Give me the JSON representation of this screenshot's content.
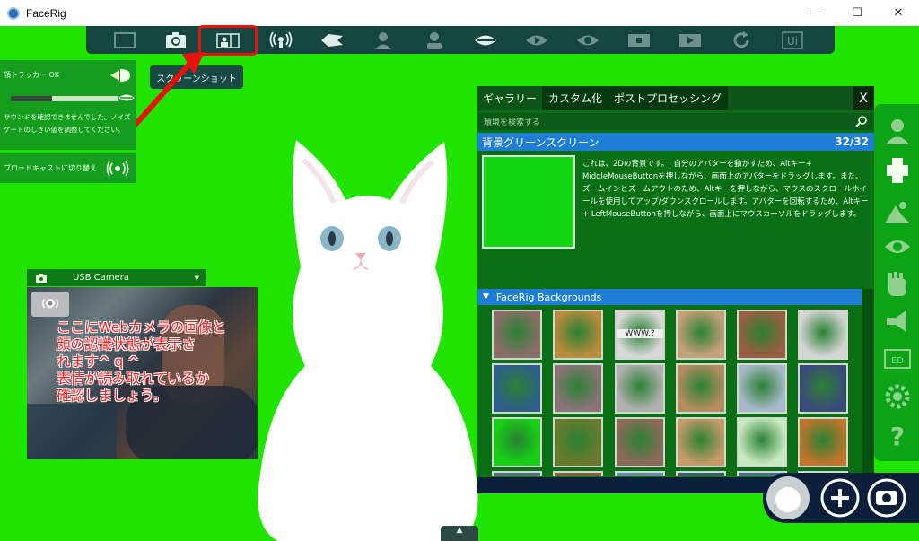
{
  "window": {
    "title": "FaceRig",
    "minimize": "—",
    "maximize": "☐",
    "close": "✕"
  },
  "toolbar": {
    "items": [
      {
        "name": "fullscreen-icon",
        "state": "dim"
      },
      {
        "name": "camera-icon",
        "state": "normal"
      },
      {
        "name": "screenshot-icon",
        "state": "active"
      },
      {
        "name": "broadcast-icon",
        "state": "normal"
      },
      {
        "name": "eye-mask-icon",
        "state": "normal"
      },
      {
        "name": "avatar-icon",
        "state": "dim"
      },
      {
        "name": "avatar-alt-icon",
        "state": "dim"
      },
      {
        "name": "lips-icon",
        "state": "normal"
      },
      {
        "name": "play-eye-icon",
        "state": "dim"
      },
      {
        "name": "record-eye-icon",
        "state": "dim"
      },
      {
        "name": "film-icon",
        "state": "dim"
      },
      {
        "name": "film-play-icon",
        "state": "dim"
      },
      {
        "name": "refresh-icon",
        "state": "dim"
      },
      {
        "name": "ui-toggle-icon",
        "state": "dim"
      }
    ],
    "ui_label": "Ui"
  },
  "tooltip": {
    "text": "スクリーンショット"
  },
  "tracker": {
    "status": "顔トラッカー OK",
    "message": "サウンドを確認できませんでした。ノイズゲートのしきい値を調整してください。",
    "slider_level": 0.38,
    "broadcast_label": "ブロードキャストに切り替え"
  },
  "camera": {
    "label": "USB Camera",
    "dropdown": "▼",
    "note": "ここにWebカメラの画像と\n顔の認識状態が表示さ\nれます^ q ^\n表情が読み取れているか\n確認しましょう。"
  },
  "gallery": {
    "tabs": [
      "ギャラリー",
      "カスタム化",
      "ポストプロセッシング"
    ],
    "close": "X",
    "search_placeholder": "環境を検索する",
    "selected_name": "背景グリーンスクリーン",
    "selected_count": "32/32",
    "description": "これは、2Dの背景です。. 自分のアバターを動かすため、Altキー+ MiddleMouseButtonを押しながら、画面上のアバターをドラッグします。また、ズームインとズームアウトのため、Altキーを押しながら、マウスのスクロールホイールを使用してアップ/ダウンスクロールします。アバターを回転するため、Altキー+ LeftMouseButtonを押しながら、画面上にマウスカーソルをドラッグします。",
    "category": "FaceRig Backgrounds",
    "category_toggle": "▼",
    "thumbnails": [
      {
        "color": "#8a6e68",
        "label": ""
      },
      {
        "color": "#b98a3c",
        "label": ""
      },
      {
        "color": "#d8d8d8",
        "label": "WWW.?"
      },
      {
        "color": "#c4a078",
        "label": ""
      },
      {
        "color": "#9a5e42",
        "label": ""
      },
      {
        "color": "#d4d4d4",
        "label": ""
      },
      {
        "color": "#2e5e8c",
        "label": ""
      },
      {
        "color": "#8a7478",
        "label": ""
      },
      {
        "color": "#b0b0b0",
        "label": ""
      },
      {
        "color": "#b48c60",
        "label": ""
      },
      {
        "color": "#a8b8c8",
        "label": ""
      },
      {
        "color": "#3a4a7a",
        "label": ""
      },
      {
        "color": "#16d216",
        "label": ""
      },
      {
        "color": "#6a7a2c",
        "label": ""
      },
      {
        "color": "#8c6a5a",
        "label": ""
      },
      {
        "color": "#c49a68",
        "label": ""
      },
      {
        "color": "#c8e8c0",
        "label": ""
      },
      {
        "color": "#c0742c",
        "label": ""
      },
      {
        "color": "#5a6a8a",
        "label": ""
      },
      {
        "color": "#8a5a3c",
        "label": ""
      },
      {
        "color": "#6a8ab0",
        "label": ""
      },
      {
        "color": "#3a5a7a",
        "label": ""
      },
      {
        "color": "#4a6a9a",
        "label": ""
      },
      {
        "color": "#2a4a6a",
        "label": ""
      }
    ]
  },
  "rightbar": {
    "icons": [
      "avatar-icon",
      "body-icon",
      "accessory-icon",
      "eye-settings-icon",
      "hand-icon",
      "megaphone-icon",
      "ed-icon",
      "gear-icon",
      "help-icon"
    ]
  },
  "bottom": {
    "handle": "▲"
  },
  "colors": {
    "greenscreen": "#1ee400",
    "panel_dark": "#14453f",
    "accent_blue": "#1e7ed6",
    "highlight_red": "#e8140c"
  }
}
